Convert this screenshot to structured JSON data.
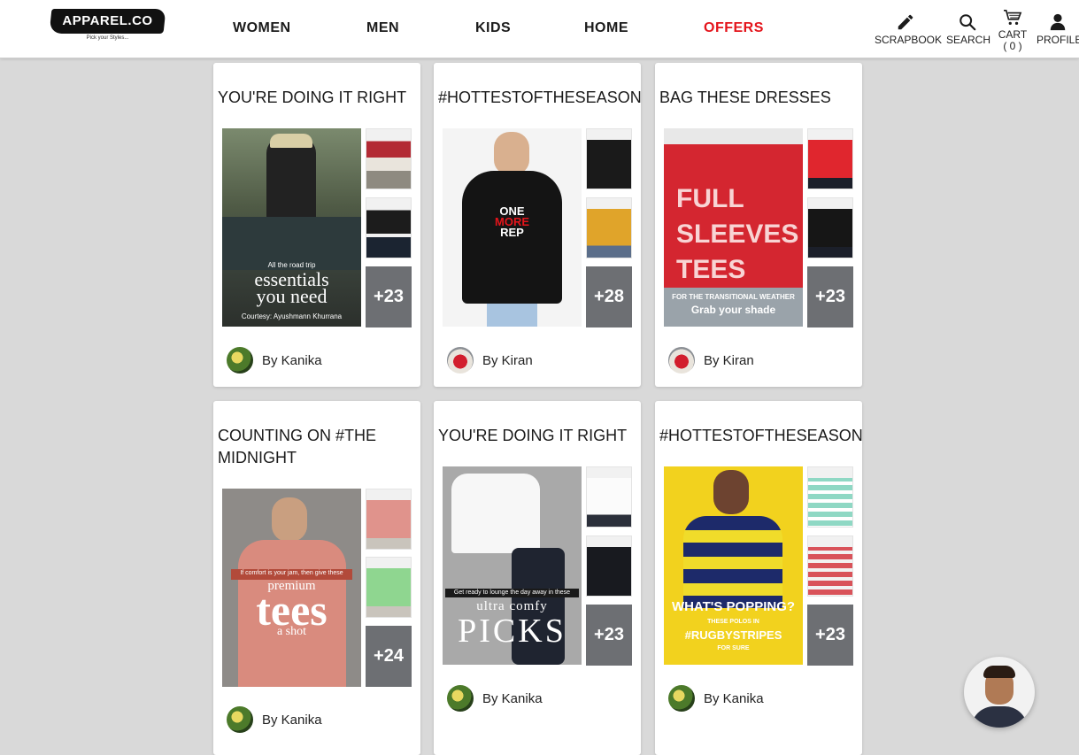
{
  "brand": {
    "name": "APPAREL.CO",
    "tagline": "Pick your Styles..."
  },
  "nav": [
    {
      "label": "WOMEN"
    },
    {
      "label": "MEN"
    },
    {
      "label": "KIDS"
    },
    {
      "label": "HOME"
    },
    {
      "label": "OFFERS",
      "color": "#e4141b"
    }
  ],
  "header_actions": {
    "scrapbook": {
      "label": "SCRAPBOOK",
      "icon": "pencil-icon"
    },
    "search": {
      "label": "SEARCH",
      "icon": "search-icon"
    },
    "cart": {
      "label": "CART",
      "count": "( 0 )",
      "icon": "cart-icon"
    },
    "profile": {
      "label": "PROFILE",
      "icon": "user-icon"
    }
  },
  "cards": [
    {
      "title": "YOU'RE DOING IT RIGHT",
      "main_image_text": [
        "All the road trip",
        "essentials",
        "you need",
        "Courtesy: Ayushmann Khurrana"
      ],
      "more_count": "+23",
      "author": "By Kanika"
    },
    {
      "title": "#HOTTESTOFTHESEASON",
      "main_image_text": [
        "ONE",
        "MORE",
        "REP"
      ],
      "more_count": "+28",
      "author": "By Kiran"
    },
    {
      "title": "BAG THESE DRESSES",
      "main_image_text": [
        "FULL",
        "SLEEVES",
        "TEES",
        "FOR THE TRANSITIONAL WEATHER",
        "Grab your shade"
      ],
      "more_count": "+23",
      "author": "By Kiran"
    },
    {
      "title": "COUNTING ON #THE MIDNIGHT",
      "main_image_text": [
        "If comfort is your jam, then give these",
        "premium",
        "tees",
        "a shot"
      ],
      "more_count": "+24",
      "author": "By Kanika"
    },
    {
      "title": "YOU'RE DOING IT RIGHT",
      "main_image_text": [
        "Get ready to lounge the day away in these",
        "ultra comfy",
        "PICKS"
      ],
      "more_count": "+23",
      "author": "By Kanika"
    },
    {
      "title": "#HOTTESTOFTHESEASON",
      "main_image_text": [
        "WHAT'S POPPING?",
        "THESE POLOS IN",
        "#RUGBYSTRIPES",
        "FOR SURE"
      ],
      "more_count": "+23",
      "author": "By Kanika"
    }
  ],
  "colors": {
    "accent": "#e4141b",
    "background": "#d9d9d9",
    "card": "#ffffff"
  }
}
